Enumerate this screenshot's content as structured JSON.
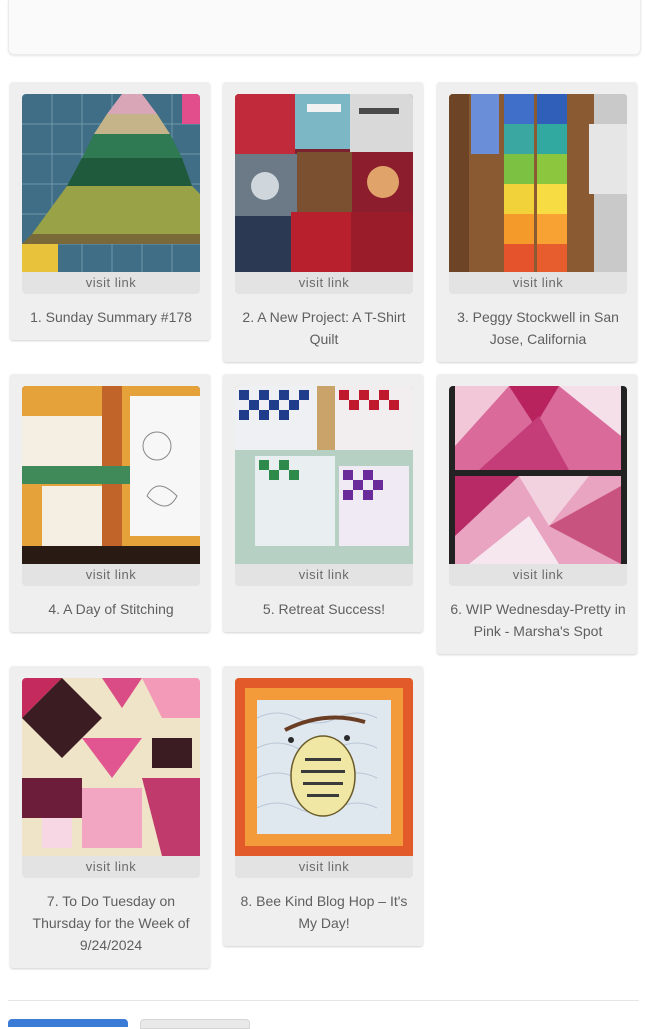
{
  "links": [
    {
      "visit_label": "visit link",
      "caption": "1. Sunday Summary #178"
    },
    {
      "visit_label": "visit link",
      "caption": "2. A New Project: A T-Shirt Quilt"
    },
    {
      "visit_label": "visit link",
      "caption": "3. Peggy Stockwell in San Jose, California"
    },
    {
      "visit_label": "visit link",
      "caption": "4. A Day of Stitching"
    },
    {
      "visit_label": "visit link",
      "caption": "5. Retreat Success!"
    },
    {
      "visit_label": "visit link",
      "caption": "6. WIP Wednesday-Pretty in Pink - Marsha's Spot"
    },
    {
      "visit_label": "visit link",
      "caption": "7. To Do Tuesday on Thursday for the Week of 9/24/2024"
    },
    {
      "visit_label": "visit link",
      "caption": "8. Bee Kind Blog Hop – It's My Day!"
    }
  ]
}
